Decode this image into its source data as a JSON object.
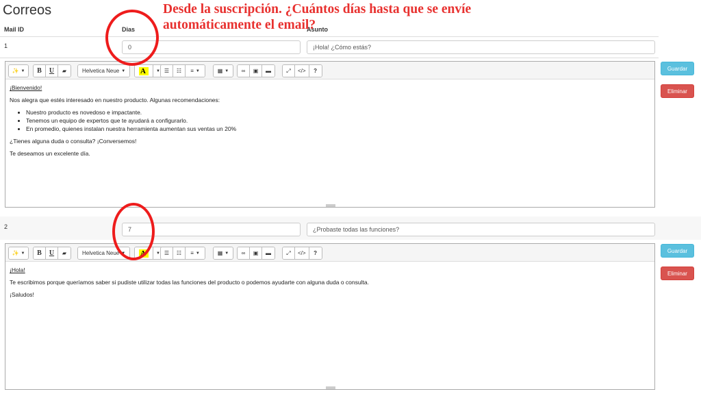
{
  "page": {
    "title": "Correos"
  },
  "columns": {
    "mail_id": "Mail ID",
    "dias": "Dias",
    "asunto": "Asunto"
  },
  "annotation": {
    "text": "Desde la suscripción. ¿Cuántos días hasta que se envíe automáticamente el email?",
    "color": "#e8312f"
  },
  "toolbar": {
    "font_name": "Helvetica Neue",
    "color_label": "A",
    "help_label": "?",
    "icons": [
      "magic-wand-icon",
      "bold-icon",
      "underline-icon",
      "eraser-icon",
      "font-family-dropdown",
      "text-color-icon",
      "unordered-list-icon",
      "ordered-list-icon",
      "paragraph-align-icon",
      "table-icon",
      "link-icon",
      "picture-icon",
      "video-icon",
      "fullscreen-icon",
      "code-view-icon",
      "help-icon"
    ],
    "bold_label": "B",
    "underline_label": "U"
  },
  "emails": [
    {
      "id": "1",
      "dias": "0",
      "asunto": "¡Hola! ¿Cómo estás?",
      "body": {
        "greeting": "¡Bienvenido!",
        "intro": "Nos alegra que estés interesado en nuestro producto. Algunas recomendaciones:",
        "bullets": [
          "Nuestro producto es novedoso e impactante.",
          "Tenemos un equipo de expertos que te ayudará a configurarlo.",
          "En promedio, quienes instalan nuestra herramienta aumentan sus ventas un 20%"
        ],
        "question": "¿Tienes alguna duda o consulta? ¡Conversemos!",
        "closing": "Te deseamos un excelente día."
      },
      "save_label": "Guardar",
      "delete_label": "Eliminar"
    },
    {
      "id": "2",
      "dias": "7",
      "asunto": "¿Probaste todas las funciones?",
      "body": {
        "greeting": "¡Hola!",
        "intro": "Te escribimos porque queríamos saber si pudiste utilizar todas las funciones del producto o podemos ayudarte con alguna duda o consulta.",
        "closing": "¡Saludos!"
      },
      "save_label": "Guardar",
      "delete_label": "Eliminar"
    }
  ],
  "colors": {
    "save": "#5bc0de",
    "delete": "#d9534f",
    "circle": "#ee1c1c"
  }
}
